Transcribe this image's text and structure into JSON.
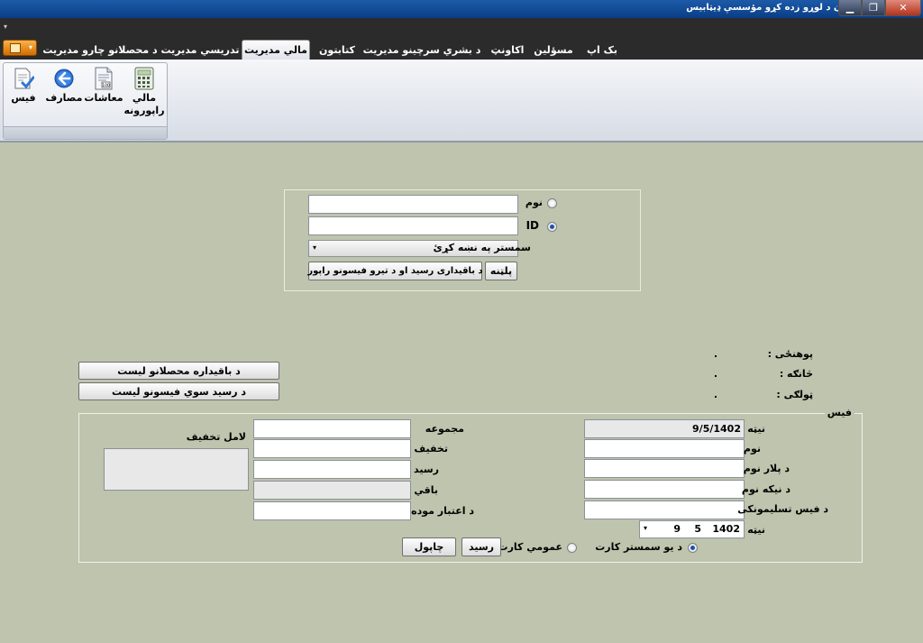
{
  "window": {
    "title": "د شیرزي افغان د لوړو زده کړو مؤسسې ډیټابیس",
    "minimize": "▁",
    "maximize": "❐",
    "close": "✕"
  },
  "qat": {
    "arrow": "▾"
  },
  "ribbon_tabs": [
    {
      "label": "بک اپ"
    },
    {
      "label": "مسؤلین"
    },
    {
      "label": "اکاونټ"
    },
    {
      "label": "د بشري سرچینو مدیریت"
    },
    {
      "label": "کتابتون"
    },
    {
      "label": "مالي مدیریت"
    },
    {
      "label": "تدریسي مدیریت"
    },
    {
      "label": "د محصلانو چارو مدیریت"
    }
  ],
  "ribbon_group": {
    "buttons": [
      {
        "label": "مالي\nراپورونه",
        "icon": "calculator-icon"
      },
      {
        "label": "معاشات",
        "icon": "payroll-document-icon"
      },
      {
        "label": "مصارف",
        "icon": "back-arrow-icon"
      },
      {
        "label": "فیس",
        "icon": "fee-check-icon"
      }
    ]
  },
  "search": {
    "name_label": "نوم",
    "name_value": "",
    "id_label": "ID",
    "id_value": "",
    "semester_label": "سمستر په نښه کړئ",
    "semester_value": "",
    "search_button": "پلټنه",
    "report_button": "د باقیداری رسید او د تیرو فیسونو راپور"
  },
  "student_info": {
    "faculty_label": "پوهنځی :",
    "faculty_value": ".",
    "department_label": "څانګه :",
    "department_value": ".",
    "class_label": "ټولګی :",
    "class_value": "."
  },
  "side_buttons": {
    "remaining_students": "د باقیداره محصلانو لیست",
    "fees_by_receipt": "د رسید سوي فیسونو لیست"
  },
  "fee": {
    "legend": "فیس",
    "date_label": "نیټه",
    "date_value": "9/5/1402",
    "name_label": "نوم",
    "name_value": "",
    "father_label": "د پلار نوم",
    "father_value": "",
    "grandfather_label": "د نیکه نوم",
    "grandfather_value": "",
    "receiver_label": "د فیس تسلیمونکی",
    "receiver_value": "",
    "date2_label": "نیټه",
    "date2_year": "1402",
    "date2_month": "5",
    "date2_day": "9",
    "total_label": "مجموعه",
    "total_value": "",
    "discount_label": "تخفیف",
    "discount_value": "",
    "receipt_label": "رسید",
    "receipt_value": "",
    "remaining_label": "باقي",
    "remaining_value": "",
    "validity_label": "د اعتبار موده",
    "validity_value": "",
    "discount_reason_label": "لامل تخفیف",
    "discount_reason_value": "",
    "semester_card": "د یو سمستر کارت",
    "general_card": "عمومي کارت",
    "receipt_button": "رسید",
    "print_button": "چاپول"
  }
}
